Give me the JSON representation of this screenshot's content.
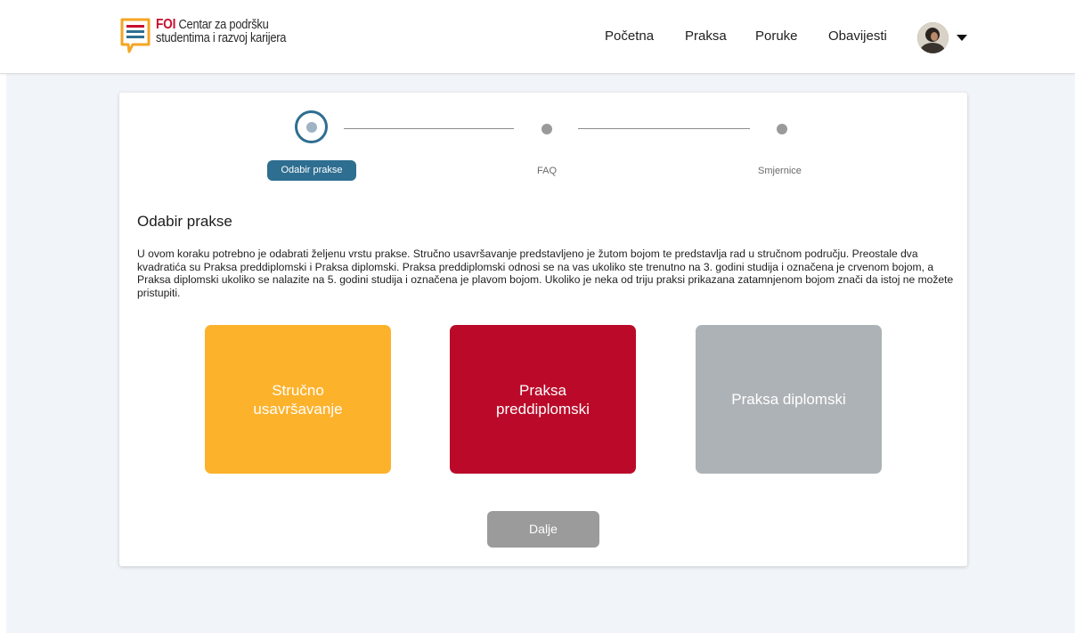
{
  "header": {
    "logo": {
      "brand": "FOI",
      "line1_rest": "Centar za podršku",
      "line2": "studentima i razvoj karijera",
      "colors": {
        "brand_red": "#c8102e",
        "bubble_orange": "#f5a623",
        "stripe_blue": "#2e6e91"
      }
    },
    "nav": [
      {
        "label": "Početna",
        "icon": null
      },
      {
        "label": "Praksa",
        "icon": null
      },
      {
        "label": "Poruke",
        "icon": null
      },
      {
        "label": "Obavijesti",
        "icon": null
      }
    ],
    "user_menu": {
      "avatar_icon": "user-avatar",
      "caret_icon": "caret-down-icon"
    }
  },
  "stepper": {
    "steps": [
      {
        "label": "Odabir prakse",
        "state": "active"
      },
      {
        "label": "FAQ",
        "state": "pending"
      },
      {
        "label": "Smjernice",
        "state": "pending"
      }
    ],
    "active_color": "#2e6e91"
  },
  "main": {
    "title": "Odabir prakse",
    "description": "U ovom koraku potrebno je odabrati željenu vrstu prakse. Stručno usavršavanje predstavljeno je žutom bojom te predstavlja rad u stručnom području. Preostale dva kvadratića su Praksa preddiplomski i Praksa diplomski. Praksa preddiplomski odnosi se na vas ukoliko ste trenutno na 3. godini studija i označena je crvenom bojom, a Praksa diplomski ukoliko se nalazite na 5. godini studija i označena je plavom bojom. Ukoliko je neka od triju praksi prikazana zatamnjenom bojom znači da istoj ne možete pristupiti.",
    "options": [
      {
        "label": "Stručno usavršavanje",
        "color": "#fdb22b",
        "state": "available"
      },
      {
        "label": "Praksa preddiplomski",
        "color": "#bb0a29",
        "state": "available"
      },
      {
        "label": "Praksa diplomski",
        "color": "#adb2b6",
        "state": "disabled"
      }
    ],
    "next_label": "Dalje"
  }
}
